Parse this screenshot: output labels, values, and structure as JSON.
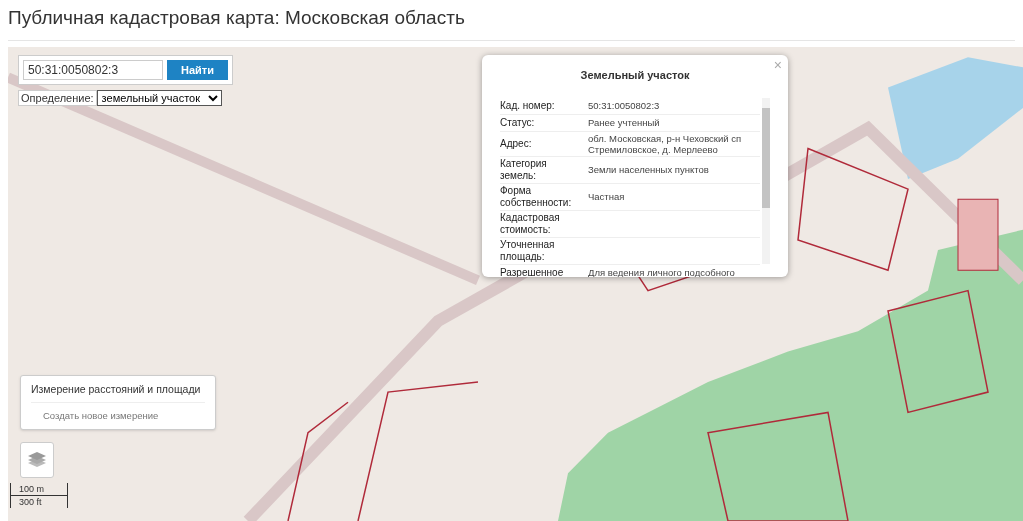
{
  "page_title": "Публичная кадастровая карта: Московская область",
  "search": {
    "value": "50:31:0050802:3",
    "button": "Найти"
  },
  "definition": {
    "label": "Определение:",
    "value": "земельный участок"
  },
  "popup": {
    "title": "Земельный участок",
    "close": "×",
    "rows": [
      {
        "label": "Кад. номер:",
        "value": "50:31:0050802:3"
      },
      {
        "label": "Статус:",
        "value": "Ранее учтенный"
      },
      {
        "label": "Адрес:",
        "value": "обл. Московская, р-н Чеховский сп Стремиловское, д. Мерлеево"
      },
      {
        "label": "Категория земель:",
        "value": "Земли населенных пунктов"
      },
      {
        "label": "Форма собственности:",
        "value": "Частная"
      },
      {
        "label": "Кадастровая стоимость:",
        "value": ""
      },
      {
        "label": "Уточненная площадь:",
        "value": ""
      },
      {
        "label": "Разрешенное",
        "value": "Для ведения личного подсобного"
      }
    ]
  },
  "measure": {
    "title": "Измерение расстояний и площади",
    "action": "Создать новое измерение"
  },
  "scale": [
    "100 m",
    "300 ft"
  ]
}
